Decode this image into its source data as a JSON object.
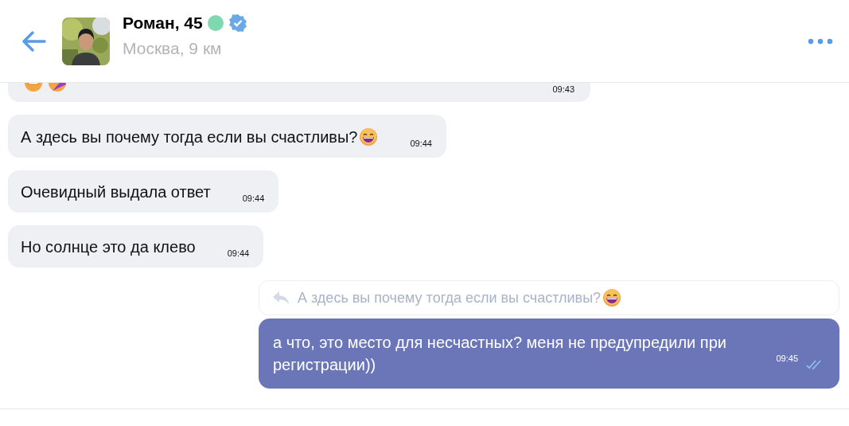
{
  "header": {
    "name": "Роман, 45",
    "online": true,
    "verified": true,
    "location": "Москва, 9 км"
  },
  "messages": [
    {
      "kind": "cut",
      "time": "09:43"
    },
    {
      "kind": "incoming",
      "text": "А здесь вы почему тогда если вы счастливы?",
      "emoji": true,
      "time": "09:44"
    },
    {
      "kind": "incoming",
      "text": "Очевидный выдала ответ",
      "emoji": false,
      "time": "09:44"
    },
    {
      "kind": "incoming",
      "text": "Но солнце это да клево",
      "emoji": false,
      "time": "09:44"
    },
    {
      "kind": "outgoing",
      "reply_to": {
        "text": "А здесь вы почему тогда если вы счастливы?",
        "emoji": true
      },
      "text": "а что, это место для несчастных? меня не предупредили при регистрации))",
      "time": "09:45",
      "read": true
    }
  ]
}
